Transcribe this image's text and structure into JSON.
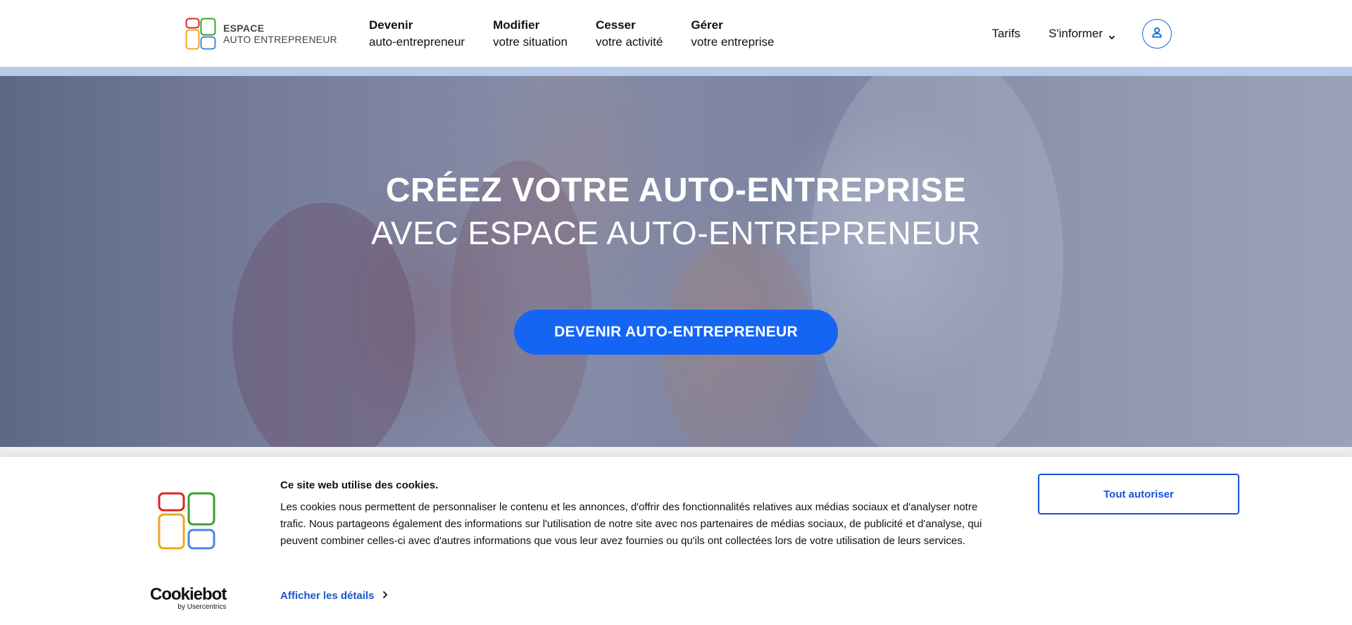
{
  "header": {
    "logo": {
      "line1": "ESPACE",
      "line2": "AUTO ENTREPRENEUR"
    },
    "nav": [
      {
        "title": "Devenir",
        "subtitle": "auto-entrepreneur"
      },
      {
        "title": "Modifier",
        "subtitle": "votre situation"
      },
      {
        "title": "Cesser",
        "subtitle": "votre activité"
      },
      {
        "title": "Gérer",
        "subtitle": "votre entreprise"
      }
    ],
    "tarifs": "Tarifs",
    "sinformer": "S'informer",
    "account_icon": "user-icon"
  },
  "hero": {
    "title": "CRÉEZ VOTRE AUTO-ENTREPRISE",
    "subtitle": "AVEC ESPACE AUTO-ENTREPRENEUR",
    "cta": "DEVENIR AUTO-ENTREPRENEUR"
  },
  "cookie_banner": {
    "title": "Ce site web utilise des cookies.",
    "text": "Les cookies nous permettent de personnaliser le contenu et les annonces, d'offrir des fonctionnalités relatives aux médias sociaux et d'analyser notre trafic. Nous partageons également des informations sur l'utilisation de notre site avec nos partenaires de médias sociaux, de publicité et d'analyse, qui peuvent combiner celles-ci avec d'autres informations que vous leur avez fournies ou qu'ils ont collectées lors de votre utilisation de leurs services.",
    "details_link": "Afficher les détails",
    "accept_button": "Tout autoriser",
    "brand": "Cookiebot",
    "brand_sub": "by Usercentrics"
  },
  "colors": {
    "accent": "#1565f5",
    "link": "#1a56c9",
    "stripe": "#b8c9ea",
    "logo_red": "#d9281f",
    "logo_green": "#3aa02d",
    "logo_orange": "#f0a81a",
    "logo_blue": "#4a86e8"
  }
}
